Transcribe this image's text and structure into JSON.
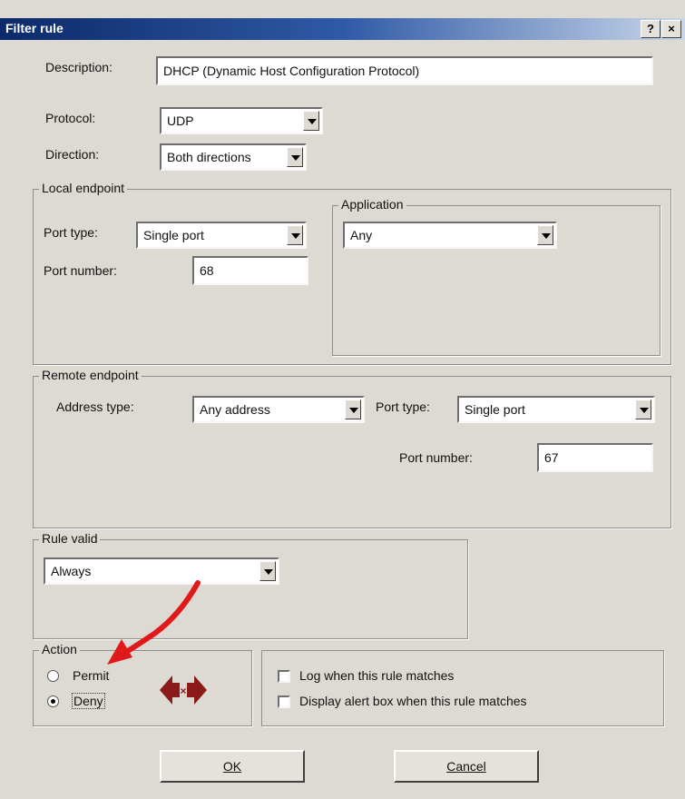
{
  "window": {
    "title": "Filter rule",
    "help_button": "?",
    "close_button": "×"
  },
  "description": {
    "label": "Description:",
    "value": "DHCP (Dynamic Host Configuration Protocol)"
  },
  "protocol": {
    "label": "Protocol:",
    "value": "UDP"
  },
  "direction": {
    "label": "Direction:",
    "value": "Both directions"
  },
  "local_endpoint": {
    "legend": "Local endpoint",
    "port_type_label": "Port type:",
    "port_type_value": "Single port",
    "port_number_label": "Port number:",
    "port_number_value": "68",
    "application_legend": "Application",
    "application_value": "Any"
  },
  "remote_endpoint": {
    "legend": "Remote endpoint",
    "address_type_label": "Address type:",
    "address_type_value": "Any address",
    "port_type_label": "Port type:",
    "port_type_value": "Single port",
    "port_number_label": "Port number:",
    "port_number_value": "67"
  },
  "rule_valid": {
    "legend": "Rule valid",
    "value": "Always"
  },
  "action": {
    "legend": "Action",
    "permit_label": "Permit",
    "deny_label": "Deny",
    "selected": "Deny"
  },
  "options": {
    "log_label": "Log when this rule matches",
    "alert_label": "Display alert box when this rule matches",
    "log_checked": false,
    "alert_checked": false
  },
  "buttons": {
    "ok": "OK",
    "cancel": "Cancel"
  },
  "colors": {
    "annotation_arrow": "#e01a1a",
    "deny_icon": "#8b1a1a",
    "title_start": "#0b2a6a"
  }
}
